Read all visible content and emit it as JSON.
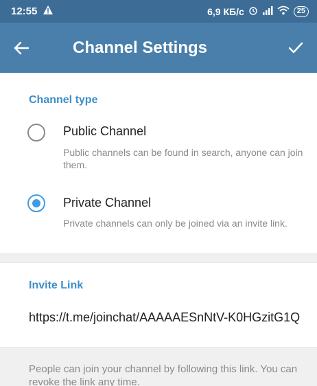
{
  "status_bar": {
    "time": "12:55",
    "warning_icon": "warning-triangle",
    "net_speed": "6,9 КБ/с",
    "battery": "25"
  },
  "toolbar": {
    "title": "Channel Settings",
    "back_icon": "arrow-left",
    "done_icon": "check"
  },
  "channel_type": {
    "header": "Channel type",
    "options": [
      {
        "title": "Public Channel",
        "description": "Public channels can be found in search, anyone can join them.",
        "selected": false
      },
      {
        "title": "Private Channel",
        "description": "Private channels can only be joined via an invite link.",
        "selected": true
      }
    ]
  },
  "invite": {
    "header": "Invite Link",
    "link": "https://t.me/joinchat/AAAAAESnNtV-K0HGzitG1Q",
    "footer": "People can join your channel by following this link. You can revoke the link any time."
  },
  "colors": {
    "status_bar": "#3d6d97",
    "toolbar": "#4a7fab",
    "accent": "#3d8ec9",
    "radio_checked": "#3f9be5"
  }
}
